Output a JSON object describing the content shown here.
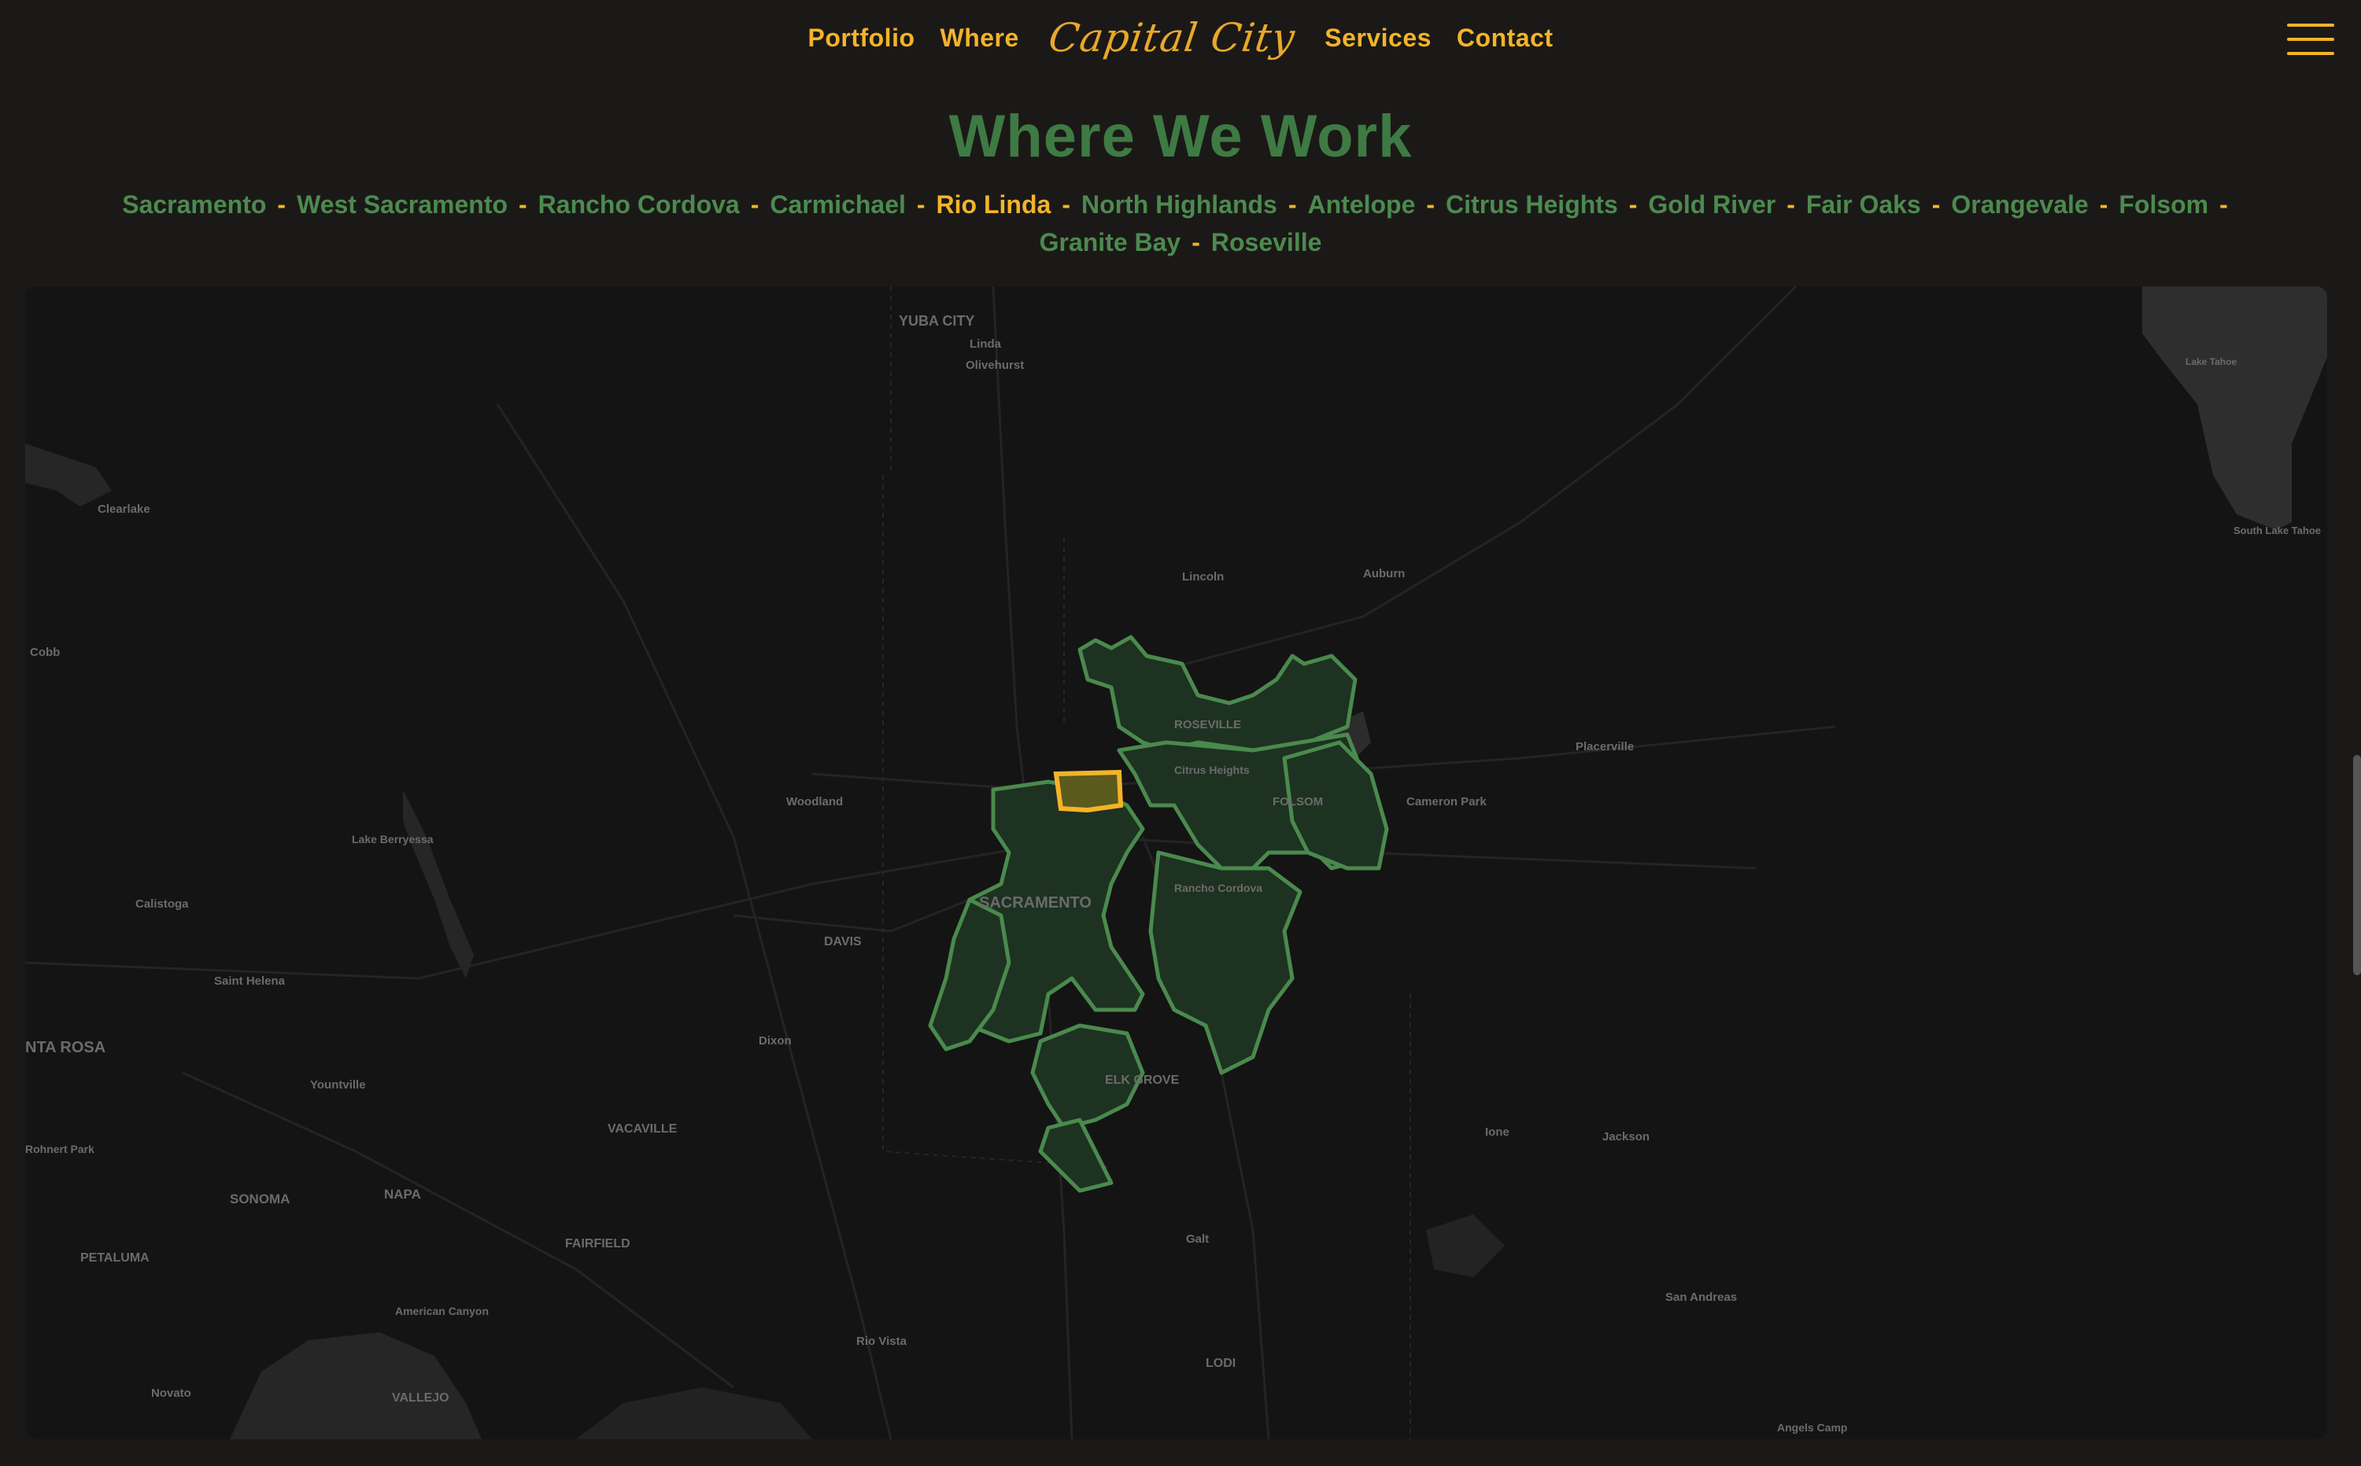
{
  "nav": {
    "links": [
      "Portfolio",
      "Where",
      "Services",
      "Contact"
    ],
    "logo": "Capital City"
  },
  "heading": "Where We Work",
  "areas": [
    {
      "name": "Sacramento",
      "active": false
    },
    {
      "name": "West Sacramento",
      "active": false
    },
    {
      "name": "Rancho Cordova",
      "active": false
    },
    {
      "name": "Carmichael",
      "active": false
    },
    {
      "name": "Rio Linda",
      "active": true
    },
    {
      "name": "North Highlands",
      "active": false
    },
    {
      "name": "Antelope",
      "active": false
    },
    {
      "name": "Citrus Heights",
      "active": false
    },
    {
      "name": "Gold River",
      "active": false
    },
    {
      "name": "Fair Oaks",
      "active": false
    },
    {
      "name": "Orangevale",
      "active": false
    },
    {
      "name": "Folsom",
      "active": false
    },
    {
      "name": "Granite Bay",
      "active": false
    },
    {
      "name": "Roseville",
      "active": false
    }
  ],
  "separator": "-",
  "map_labels": {
    "yuba_city": "YUBA CITY",
    "linda": "Linda",
    "olivehurst": "Olivehurst",
    "clearlake": "Clearlake",
    "cobb": "Cobb",
    "lincoln": "Lincoln",
    "auburn": "Auburn",
    "roseville": "ROSEVILLE",
    "citrus_heights": "Citrus Heights",
    "folsom": "FOLSOM",
    "placerville": "Placerville",
    "cameron_park": "Cameron Park",
    "woodland": "Woodland",
    "lake_berryessa": "Lake Berryessa",
    "calistoga": "Calistoga",
    "sacramento": "SACRAMENTO",
    "rancho_cordova": "Rancho Cordova",
    "davis": "DAVIS",
    "saint_helena": "Saint Helena",
    "santa_rosa": "NTA ROSA",
    "dixon": "Dixon",
    "yountville": "Yountville",
    "elk_grove": "ELK GROVE",
    "vacaville": "VACAVILLE",
    "rohnert_park": "Rohnert Park",
    "ione": "Ione",
    "jackson": "Jackson",
    "sonoma": "SONOMA",
    "napa": "NAPA",
    "fairfield": "FAIRFIELD",
    "petaluma": "PETALUMA",
    "galt": "Galt",
    "san_andreas": "San Andreas",
    "american_canyon": "American Canyon",
    "rio_vista": "Rio Vista",
    "lodi": "LODI",
    "novato": "Novato",
    "vallejo": "VALLEJO",
    "angels_camp": "Angels Camp",
    "lake_tahoe": "Lake Tahoe",
    "south_lake_tahoe": "South Lake Tahoe"
  },
  "colors": {
    "accent": "#f2b429",
    "green": "#3e7a43",
    "area_fill": "#1f3322",
    "area_stroke": "#4a8a4d",
    "selected_fill": "#5a5a1c"
  }
}
